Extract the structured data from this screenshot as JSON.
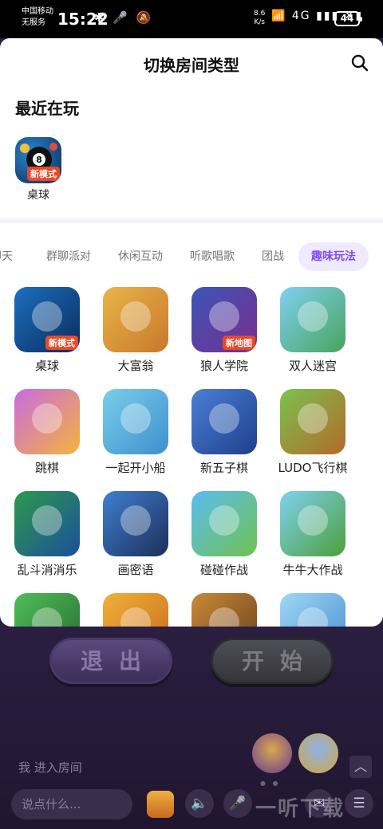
{
  "status": {
    "carrier_line1": "中国移动",
    "carrier_line2": "无服务",
    "time": "15:22",
    "left_icons": "✱ 🎤 🔕",
    "net_speed": "8.6",
    "net_unit": "K/s",
    "right_icons": "📶 4G ▮▮▮ ✕▮",
    "battery": "44"
  },
  "sheet": {
    "title": "切换房间类型",
    "recent_title": "最近在玩",
    "recent_games": [
      {
        "label": "桌球",
        "tag": "新模式",
        "color1": "#0d5c9a",
        "color2": "#0b2c56"
      }
    ],
    "tabs": [
      "聊天",
      "群聊派对",
      "休闲互动",
      "听歌唱歌",
      "团战",
      "趣味玩法"
    ],
    "active_tab": "趣味玩法",
    "games": [
      {
        "label": "桌球",
        "tag": "新模式",
        "color1": "#1b6fbf",
        "color2": "#0a2d5e"
      },
      {
        "label": "大富翁",
        "tag": "",
        "color1": "#e9b54a",
        "color2": "#c8782a"
      },
      {
        "label": "狼人学院",
        "tag": "新地图",
        "color1": "#3a55b8",
        "color2": "#7a2e8e"
      },
      {
        "label": "双人迷宫",
        "tag": "",
        "color1": "#7fd0f5",
        "color2": "#4aa35c"
      },
      {
        "label": "跳棋",
        "tag": "",
        "color1": "#c96be0",
        "color2": "#f4b43a"
      },
      {
        "label": "一起开小船",
        "tag": "",
        "color1": "#79cfe9",
        "color2": "#3f8fcf"
      },
      {
        "label": "新五子棋",
        "tag": "",
        "color1": "#4b7fd6",
        "color2": "#1e3f8c"
      },
      {
        "label": "LUDO飞行棋",
        "tag": "",
        "color1": "#7ac24e",
        "color2": "#b36a2a"
      },
      {
        "label": "乱斗消消乐",
        "tag": "",
        "color1": "#2e9a4c",
        "color2": "#1b4f9a"
      },
      {
        "label": "画密语",
        "tag": "",
        "color1": "#3f7fd0",
        "color2": "#1d2f5a"
      },
      {
        "label": "碰碰作战",
        "tag": "",
        "color1": "#5bbcf0",
        "color2": "#6fc24f"
      },
      {
        "label": "牛牛大作战",
        "tag": "",
        "color1": "#7fd2f0",
        "color2": "#4d9e3a"
      },
      {
        "label": "",
        "tag": "",
        "color1": "#4fbf5a",
        "color2": "#2a6a2f"
      },
      {
        "label": "",
        "tag": "",
        "color1": "#f0b13a",
        "color2": "#c96c1c"
      },
      {
        "label": "",
        "tag": "",
        "color1": "#c98a3a",
        "color2": "#6a3f1a"
      },
      {
        "label": "",
        "tag": "",
        "color1": "#9fd8f5",
        "color2": "#4a8ed0"
      }
    ]
  },
  "room": {
    "exit_label": "退出",
    "start_label": "开始",
    "message": "我 进入房间",
    "chat_placeholder": "说点什么...",
    "scroll_up_icon": "︿",
    "speaker_icon": "🔈",
    "mic_icon": "🎤",
    "mail_icon": "✉",
    "menu_icon": "☰",
    "watermark": "一听下载"
  }
}
